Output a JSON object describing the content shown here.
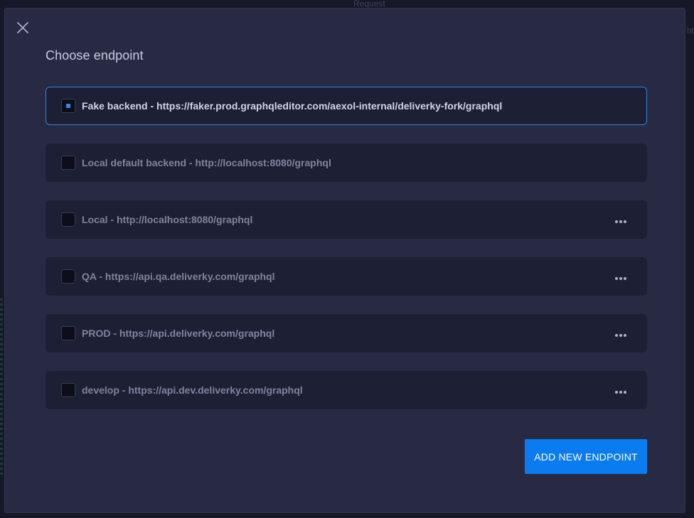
{
  "background": {
    "top_hint": "Request",
    "right_hint": "ht"
  },
  "modal": {
    "close_icon": "close-icon",
    "title": "Choose endpoint",
    "endpoints": [
      {
        "label": "Fake backend - https://faker.prod.graphqleditor.com/aexol-internal/deliverky-fork/graphql",
        "selected": true,
        "has_menu": false
      },
      {
        "label": "Local default backend - http://localhost:8080/graphql",
        "selected": false,
        "has_menu": false
      },
      {
        "label": "Local - http://localhost:8080/graphql",
        "selected": false,
        "has_menu": true
      },
      {
        "label": "QA - https://api.qa.deliverky.com/graphql",
        "selected": false,
        "has_menu": true
      },
      {
        "label": "PROD - https://api.deliverky.com/graphql",
        "selected": false,
        "has_menu": true
      },
      {
        "label": "develop - https://api.dev.deliverky.com/graphql",
        "selected": false,
        "has_menu": true
      }
    ],
    "add_button_label": "ADD NEW ENDPOINT"
  },
  "colors": {
    "accent": "#0a7cf0",
    "selected_border": "#2f83e6",
    "modal_bg": "#272a42",
    "row_bg": "#1d1f34"
  }
}
